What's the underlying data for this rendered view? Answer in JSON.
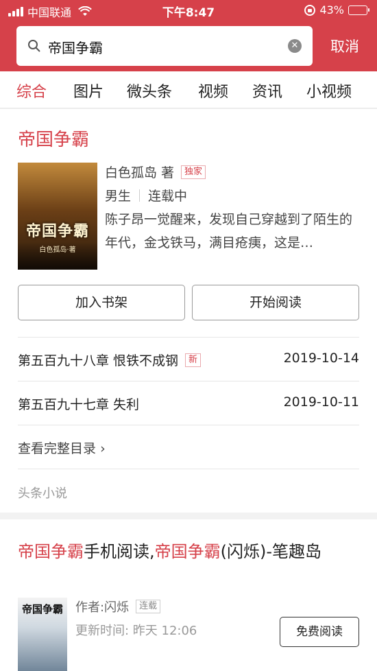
{
  "status_bar": {
    "carrier": "中国联通",
    "time": "下午8:47",
    "battery": "43%",
    "battery_level": 0.43
  },
  "search": {
    "query": "帝国争霸",
    "cancel_label": "取消"
  },
  "tabs": [
    {
      "label": "综合",
      "active": true
    },
    {
      "label": "图片",
      "active": false
    },
    {
      "label": "微头条",
      "active": false
    },
    {
      "label": "视频",
      "active": false
    },
    {
      "label": "资讯",
      "active": false
    },
    {
      "label": "小视频",
      "active": false
    }
  ],
  "book": {
    "title": "帝国争霸",
    "cover_title": "帝国争霸",
    "cover_subtitle": "白色孤岛·著",
    "author": "白色孤岛 著",
    "exclusive_badge": "独家",
    "category": "男生",
    "status": "连载中",
    "description": "陈子昂一觉醒来，发现自己穿越到了陌生的年代，金戈铁马，满目疮痍，这是…",
    "add_shelf_label": "加入书架",
    "start_read_label": "开始阅读",
    "chapters": [
      {
        "name": "第五百九十八章 恨铁不成钢",
        "badge": "新",
        "date": "2019-10-14"
      },
      {
        "name": "第五百九十七章 失利",
        "badge": "",
        "date": "2019-10-11"
      }
    ],
    "full_toc_label": "查看完整目录",
    "source": "头条小说"
  },
  "result2": {
    "title_part1": "帝国争霸",
    "title_part2": "手机阅读,",
    "title_part3": "帝国争霸",
    "title_part4": "(闪烁)-笔趣岛",
    "cover_title": "帝国争霸",
    "author": "作者:闪烁",
    "status_badge": "连载",
    "updated": "更新时间: 昨天 12:06",
    "free_read_label": "免费阅读"
  },
  "colors": {
    "accent": "#d6414a",
    "battery_fill": "#f6c12d"
  }
}
